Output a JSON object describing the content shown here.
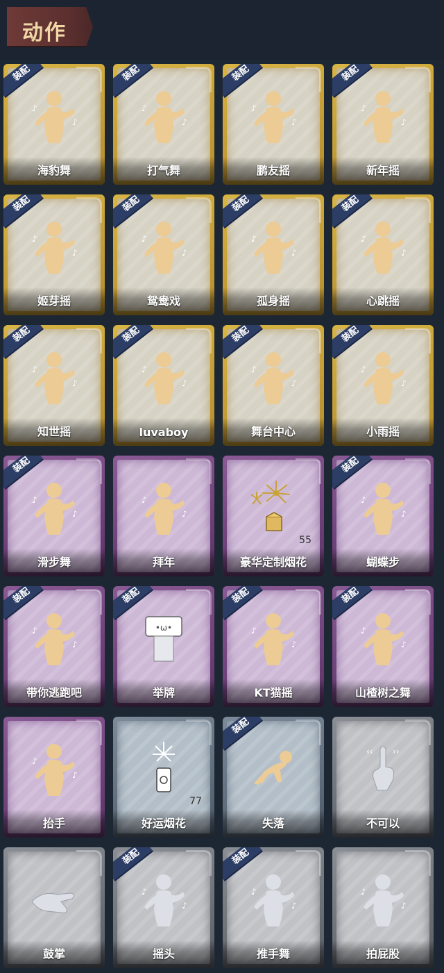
{
  "header": {
    "title": "动作"
  },
  "badge_label": "装配",
  "cards": [
    {
      "label": "海豹舞",
      "tier": "gold",
      "equipped": true,
      "icon": "dance-figure-icon"
    },
    {
      "label": "打气舞",
      "tier": "gold",
      "equipped": true,
      "icon": "dance-figure-icon"
    },
    {
      "label": "鹏友摇",
      "tier": "gold",
      "equipped": true,
      "icon": "dance-figure-icon"
    },
    {
      "label": "新年摇",
      "tier": "gold",
      "equipped": true,
      "icon": "dance-figure-icon"
    },
    {
      "label": "姬芽摇",
      "tier": "gold",
      "equipped": true,
      "icon": "dance-figure-icon"
    },
    {
      "label": "鸳鸯戏",
      "tier": "gold",
      "equipped": true,
      "icon": "dance-figure-icon"
    },
    {
      "label": "孤身摇",
      "tier": "gold",
      "equipped": true,
      "icon": "dance-figure-icon"
    },
    {
      "label": "心跳摇",
      "tier": "gold",
      "equipped": true,
      "icon": "dance-figure-icon"
    },
    {
      "label": "知世摇",
      "tier": "gold",
      "equipped": true,
      "icon": "dance-figure-icon"
    },
    {
      "label": "luvaboy",
      "tier": "gold",
      "equipped": true,
      "icon": "dance-figure-icon"
    },
    {
      "label": "舞台中心",
      "tier": "gold",
      "equipped": true,
      "icon": "dance-figure-icon"
    },
    {
      "label": "小雨摇",
      "tier": "gold",
      "equipped": true,
      "icon": "dance-figure-icon"
    },
    {
      "label": "滑步舞",
      "tier": "purple",
      "equipped": true,
      "icon": "dance-figure-icon"
    },
    {
      "label": "拜年",
      "tier": "purple",
      "equipped": false,
      "icon": "bow-figure-icon"
    },
    {
      "label": "豪华定制烟花",
      "tier": "purple",
      "equipped": false,
      "icon": "fireworks-icon",
      "count": "55"
    },
    {
      "label": "蝴蝶步",
      "tier": "purple",
      "equipped": true,
      "icon": "dance-figure-icon"
    },
    {
      "label": "带你逃跑吧",
      "tier": "purple",
      "equipped": true,
      "icon": "dance-figure-icon"
    },
    {
      "label": "举牌",
      "tier": "purple",
      "equipped": true,
      "icon": "sign-figure-icon"
    },
    {
      "label": "KT猫摇",
      "tier": "purple",
      "equipped": true,
      "icon": "dance-figure-icon"
    },
    {
      "label": "山楂树之舞",
      "tier": "purple",
      "equipped": true,
      "icon": "dance-figure-icon"
    },
    {
      "label": "抬手",
      "tier": "purple",
      "equipped": false,
      "icon": "raise-hand-figure-icon"
    },
    {
      "label": "好运烟花",
      "tier": "steel",
      "equipped": false,
      "icon": "firecracker-icon",
      "count": "77"
    },
    {
      "label": "失落",
      "tier": "steel",
      "equipped": true,
      "icon": "crawl-figure-icon"
    },
    {
      "label": "不可以",
      "tier": "grey",
      "equipped": false,
      "icon": "finger-wag-icon"
    },
    {
      "label": "鼓掌",
      "tier": "grey",
      "equipped": false,
      "icon": "clap-hands-icon"
    },
    {
      "label": "摇头",
      "tier": "grey",
      "equipped": true,
      "icon": "shake-head-figure-icon"
    },
    {
      "label": "推手舞",
      "tier": "grey",
      "equipped": true,
      "icon": "push-hand-figure-icon"
    },
    {
      "label": "拍屁股",
      "tier": "grey",
      "equipped": false,
      "icon": "pat-figure-icon"
    }
  ]
}
